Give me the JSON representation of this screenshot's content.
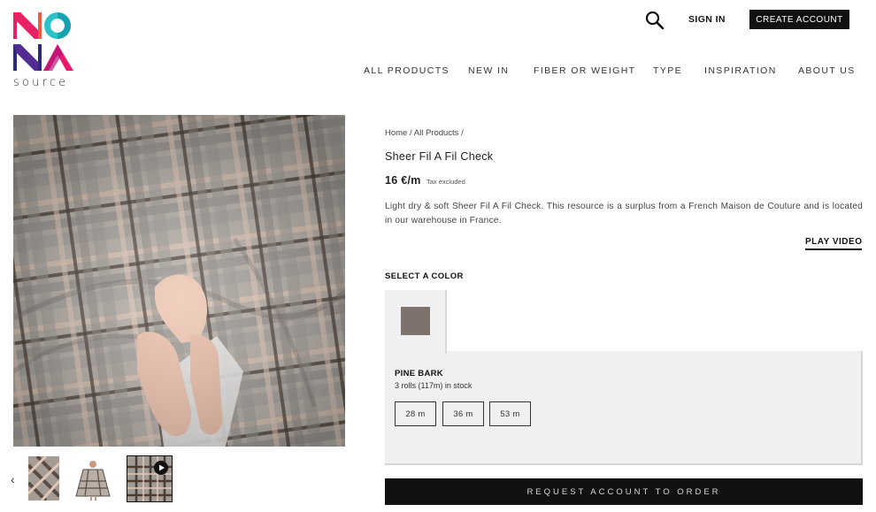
{
  "brand": {
    "letters": [
      "N",
      "O",
      "N",
      "A"
    ],
    "word": "source",
    "colors": {
      "magenta": "#e8196c",
      "cyan": "#2bc3c9",
      "navy": "#2d2a7c",
      "pink": "#e8196c"
    }
  },
  "header": {
    "search_icon": "search-icon",
    "sign_in": "SIGN IN",
    "create_account": "CREATE ACCOUNT"
  },
  "nav": {
    "items": [
      {
        "label": "ALL PRODUCTS"
      },
      {
        "label": "NEW IN"
      },
      {
        "label": "FIBER OR WEIGHT"
      },
      {
        "label": "TYPE"
      },
      {
        "label": "INSPIRATION"
      },
      {
        "label": "ABOUT US"
      }
    ]
  },
  "gallery": {
    "prev_icon": "chevron-left-icon",
    "prev_glyph": "‹",
    "thumbnails": [
      "fabric-swatch",
      "garment-model",
      "fabric-video"
    ],
    "play_icon": "play-icon"
  },
  "product": {
    "breadcrumb": {
      "home": "Home",
      "sep1": " / ",
      "all_products": "All Products",
      "sep2": " /"
    },
    "title": "Sheer Fil A Fil Check",
    "price": "16 €/m",
    "tax_note": "Tax excluded",
    "description": "Light dry & soft Sheer Fil A Fil Check. This resource is a surplus from a French Maison de Couture and is located in our warehouse in France.",
    "play_video": "PLAY VIDEO",
    "select_color_label": "SELECT A COLOR",
    "color": {
      "name": "PINE BARK",
      "stock": "3 rolls (117m) in stock",
      "swatch_color": "#7d726c",
      "lengths": [
        "28 m",
        "36 m",
        "53 m"
      ]
    },
    "request_button": "REQUEST ACCOUNT TO ORDER"
  }
}
